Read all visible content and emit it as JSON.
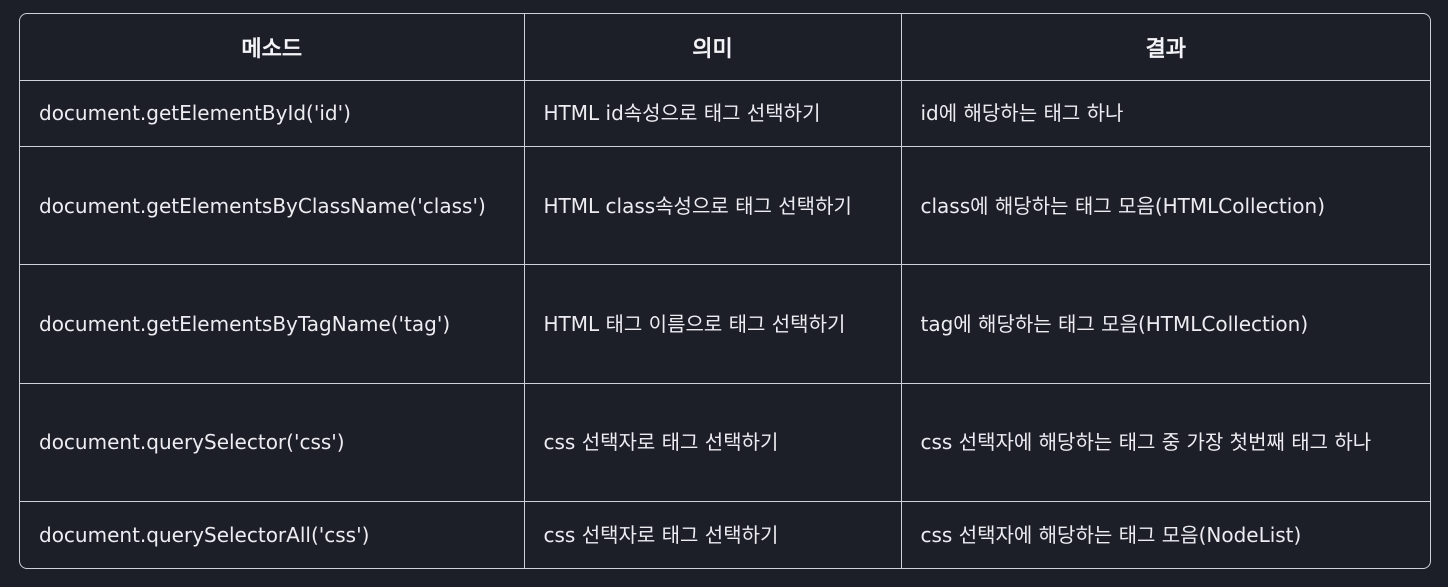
{
  "table": {
    "headers": [
      "메소드",
      "의미",
      "결과"
    ],
    "rows": [
      {
        "method": "document.getElementById('id')",
        "meaning": "HTML id속성으로 태그 선택하기",
        "result": "id에 해당하는 태그 하나"
      },
      {
        "method": "document.getElementsByClassName('class')",
        "meaning": "HTML class속성으로 태그 선택하기",
        "result": "class에 해당하는 태그 모음(HTMLCollection)"
      },
      {
        "method": "document.getElementsByTagName('tag')",
        "meaning": "HTML 태그 이름으로 태그 선택하기",
        "result": "tag에 해당하는 태그 모음(HTMLCollection)"
      },
      {
        "method": "document.querySelector('css')",
        "meaning": "css 선택자로 태그 선택하기",
        "result": "css 선택자에 해당하는 태그 중 가장 첫번째 태그 하나"
      },
      {
        "method": "document.querySelectorAll('css')",
        "meaning": "css 선택자로 태그 선택하기",
        "result": "css 선택자에 해당하는 태그 모음(NodeList)"
      }
    ]
  }
}
